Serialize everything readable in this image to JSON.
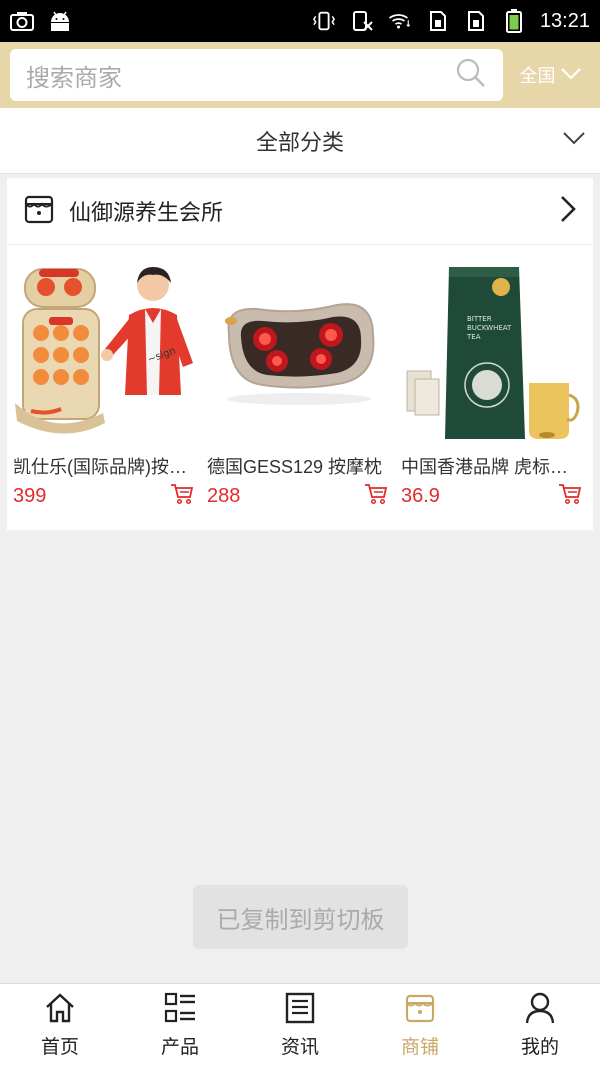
{
  "status_bar": {
    "time": "13:21",
    "left_icons": [
      "camera-icon",
      "android-icon"
    ],
    "right_icons": [
      "vibrate-icon",
      "no-sim-icon",
      "wifi-icon",
      "sim-card-icon",
      "sim-card-icon",
      "battery-icon"
    ]
  },
  "search": {
    "placeholder": "搜索商家",
    "region": "全国"
  },
  "category": {
    "label": "全部分类"
  },
  "shop": {
    "name": "仙御源养生会所",
    "products": [
      {
        "title": "凯仕乐(国际品牌)按摩椅",
        "price": "399"
      },
      {
        "title": "德国GESS129 按摩枕",
        "price": "288"
      },
      {
        "title": "中国香港品牌 虎标苦荞茶",
        "price": "36.9"
      }
    ],
    "tea_package_text": [
      "BITTER",
      "BUCKWHEAT",
      "TEA"
    ]
  },
  "toast": {
    "text": "已复制到剪切板"
  },
  "bottom_nav": [
    {
      "label": "首页",
      "icon": "home-icon",
      "active": false
    },
    {
      "label": "产品",
      "icon": "list-icon",
      "active": false
    },
    {
      "label": "资讯",
      "icon": "news-icon",
      "active": false
    },
    {
      "label": "商铺",
      "icon": "store-icon",
      "active": true
    },
    {
      "label": "我的",
      "icon": "user-icon",
      "active": false
    }
  ],
  "colors": {
    "header_bg": "#e6d6a8",
    "accent": "#c9a867",
    "price": "#e32b2b"
  }
}
